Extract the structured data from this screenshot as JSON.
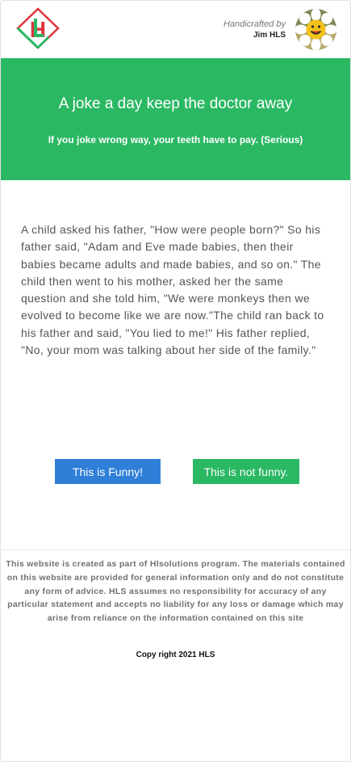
{
  "header": {
    "logo_letters": "HL",
    "logo_icon": "hls-logo-icon",
    "credit_line": "Handicrafted by",
    "author": "Jim HLS",
    "avatar_icon": "daisy-smiley-avatar"
  },
  "hero": {
    "title": "A joke a day keep the doctor away",
    "subtitle": "If you joke wrong way, your teeth have to pay. (Serious)"
  },
  "joke": {
    "text": "A child asked his father, \"How were people born?\" So his father said, \"Adam and Eve made babies, then their babies became adults and made babies, and so on.\" The child then went to his mother, asked her the same question and she told him, \"We were monkeys then we evolved to become like we are now.\"The child ran back to his father and said, \"You lied to me!\" His father replied, \"No, your mom was talking about her side of the family.\""
  },
  "buttons": {
    "funny": "This is Funny!",
    "not_funny": "This is not funny."
  },
  "footer": {
    "disclaimer": "This website is created as part of Hlsolutions program. The materials contained on this website are provided for general information only and do not constitute any form of advice. HLS assumes no responsibility for accuracy of any particular statement and accepts no liability for any loss or damage which may arise from reliance on the information contained on this site",
    "copyright": "Copy right 2021 HLS"
  },
  "colors": {
    "brand_green": "#2bb863",
    "funny_blue": "#2f7fd8",
    "logo_red": "#e0343a"
  }
}
